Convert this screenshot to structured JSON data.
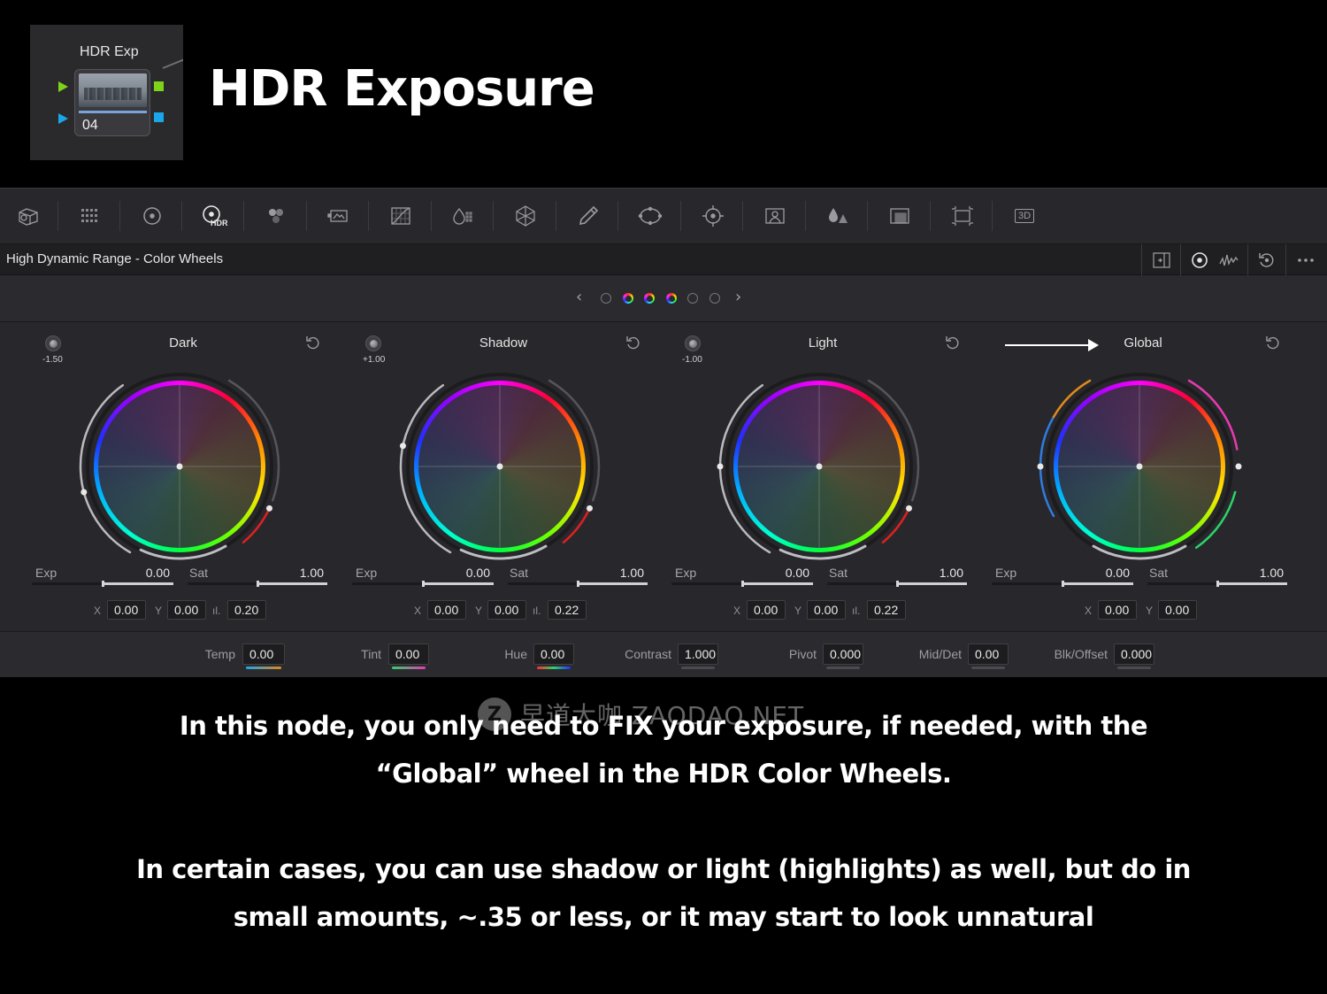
{
  "node": {
    "label": "HDR Exp",
    "number": "04"
  },
  "page_title": "HDR Exposure",
  "panel": {
    "title": "High Dynamic Range - Color Wheels",
    "hdr_tag": "HDR",
    "d3_tag": "3D"
  },
  "wheels": [
    {
      "name": "Dark",
      "knob": "-1.50",
      "exp_label": "Exp",
      "exp": "0.00",
      "sat_label": "Sat",
      "sat": "1.00",
      "x_label": "X",
      "x": "0.00",
      "y_label": "Y",
      "y": "0.00",
      "z": "0.20"
    },
    {
      "name": "Shadow",
      "knob": "+1.00",
      "exp_label": "Exp",
      "exp": "0.00",
      "sat_label": "Sat",
      "sat": "1.00",
      "x_label": "X",
      "x": "0.00",
      "y_label": "Y",
      "y": "0.00",
      "z": "0.22"
    },
    {
      "name": "Light",
      "knob": "-1.00",
      "exp_label": "Exp",
      "exp": "0.00",
      "sat_label": "Sat",
      "sat": "1.00",
      "x_label": "X",
      "x": "0.00",
      "y_label": "Y",
      "y": "0.00",
      "z": "0.22"
    },
    {
      "name": "Global",
      "knob": "",
      "exp_label": "Exp",
      "exp": "0.00",
      "sat_label": "Sat",
      "sat": "1.00",
      "x_label": "X",
      "x": "0.00",
      "y_label": "Y",
      "y": "0.00",
      "z": ""
    }
  ],
  "bottom": [
    {
      "label": "Temp",
      "value": "0.00"
    },
    {
      "label": "Tint",
      "value": "0.00"
    },
    {
      "label": "Hue",
      "value": "0.00"
    },
    {
      "label": "Contrast",
      "value": "1.000"
    },
    {
      "label": "Pivot",
      "value": "0.000"
    },
    {
      "label": "Mid/Det",
      "value": "0.00"
    },
    {
      "label": "Blk/Offset",
      "value": "0.000"
    }
  ],
  "caption": {
    "line1": "In this node, you only need to FIX your exposure, if needed, with the",
    "line2": "“Global” wheel in the HDR Color Wheels.",
    "line3": "In certain cases, you can use shadow or light (highlights) as well, but do in",
    "line4": "small amounts, ~.35 or less, or it may start to look unnatural"
  },
  "watermark": {
    "logo": "Z",
    "text": "早道大咖  ZAODAO.NET"
  },
  "colors": {
    "accent_blue": "#1aa6e8",
    "accent_green": "#7fd21a",
    "panel_bg": "#28282c"
  }
}
